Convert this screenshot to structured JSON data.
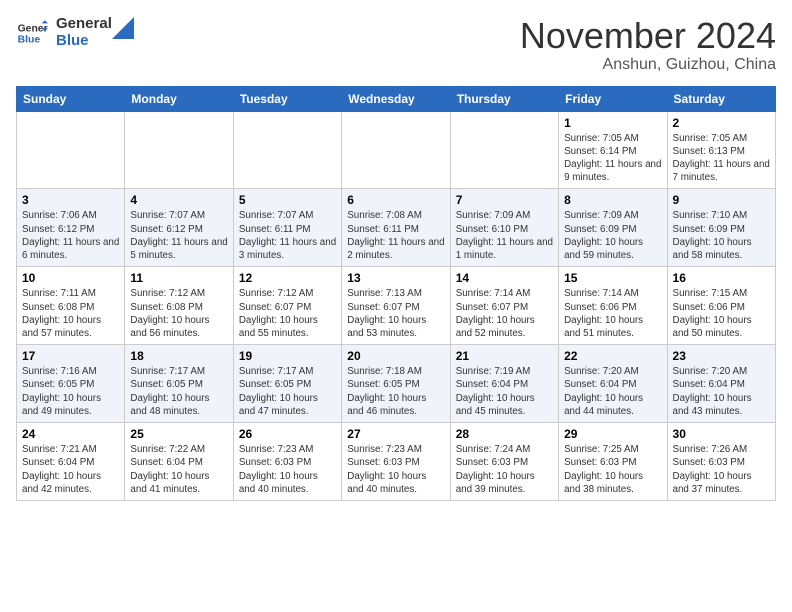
{
  "header": {
    "logo_line1": "General",
    "logo_line2": "Blue",
    "month": "November 2024",
    "location": "Anshun, Guizhou, China"
  },
  "weekdays": [
    "Sunday",
    "Monday",
    "Tuesday",
    "Wednesday",
    "Thursday",
    "Friday",
    "Saturday"
  ],
  "weeks": [
    [
      {
        "day": "",
        "info": ""
      },
      {
        "day": "",
        "info": ""
      },
      {
        "day": "",
        "info": ""
      },
      {
        "day": "",
        "info": ""
      },
      {
        "day": "",
        "info": ""
      },
      {
        "day": "1",
        "info": "Sunrise: 7:05 AM\nSunset: 6:14 PM\nDaylight: 11 hours and 9 minutes."
      },
      {
        "day": "2",
        "info": "Sunrise: 7:05 AM\nSunset: 6:13 PM\nDaylight: 11 hours and 7 minutes."
      }
    ],
    [
      {
        "day": "3",
        "info": "Sunrise: 7:06 AM\nSunset: 6:12 PM\nDaylight: 11 hours and 6 minutes."
      },
      {
        "day": "4",
        "info": "Sunrise: 7:07 AM\nSunset: 6:12 PM\nDaylight: 11 hours and 5 minutes."
      },
      {
        "day": "5",
        "info": "Sunrise: 7:07 AM\nSunset: 6:11 PM\nDaylight: 11 hours and 3 minutes."
      },
      {
        "day": "6",
        "info": "Sunrise: 7:08 AM\nSunset: 6:11 PM\nDaylight: 11 hours and 2 minutes."
      },
      {
        "day": "7",
        "info": "Sunrise: 7:09 AM\nSunset: 6:10 PM\nDaylight: 11 hours and 1 minute."
      },
      {
        "day": "8",
        "info": "Sunrise: 7:09 AM\nSunset: 6:09 PM\nDaylight: 10 hours and 59 minutes."
      },
      {
        "day": "9",
        "info": "Sunrise: 7:10 AM\nSunset: 6:09 PM\nDaylight: 10 hours and 58 minutes."
      }
    ],
    [
      {
        "day": "10",
        "info": "Sunrise: 7:11 AM\nSunset: 6:08 PM\nDaylight: 10 hours and 57 minutes."
      },
      {
        "day": "11",
        "info": "Sunrise: 7:12 AM\nSunset: 6:08 PM\nDaylight: 10 hours and 56 minutes."
      },
      {
        "day": "12",
        "info": "Sunrise: 7:12 AM\nSunset: 6:07 PM\nDaylight: 10 hours and 55 minutes."
      },
      {
        "day": "13",
        "info": "Sunrise: 7:13 AM\nSunset: 6:07 PM\nDaylight: 10 hours and 53 minutes."
      },
      {
        "day": "14",
        "info": "Sunrise: 7:14 AM\nSunset: 6:07 PM\nDaylight: 10 hours and 52 minutes."
      },
      {
        "day": "15",
        "info": "Sunrise: 7:14 AM\nSunset: 6:06 PM\nDaylight: 10 hours and 51 minutes."
      },
      {
        "day": "16",
        "info": "Sunrise: 7:15 AM\nSunset: 6:06 PM\nDaylight: 10 hours and 50 minutes."
      }
    ],
    [
      {
        "day": "17",
        "info": "Sunrise: 7:16 AM\nSunset: 6:05 PM\nDaylight: 10 hours and 49 minutes."
      },
      {
        "day": "18",
        "info": "Sunrise: 7:17 AM\nSunset: 6:05 PM\nDaylight: 10 hours and 48 minutes."
      },
      {
        "day": "19",
        "info": "Sunrise: 7:17 AM\nSunset: 6:05 PM\nDaylight: 10 hours and 47 minutes."
      },
      {
        "day": "20",
        "info": "Sunrise: 7:18 AM\nSunset: 6:05 PM\nDaylight: 10 hours and 46 minutes."
      },
      {
        "day": "21",
        "info": "Sunrise: 7:19 AM\nSunset: 6:04 PM\nDaylight: 10 hours and 45 minutes."
      },
      {
        "day": "22",
        "info": "Sunrise: 7:20 AM\nSunset: 6:04 PM\nDaylight: 10 hours and 44 minutes."
      },
      {
        "day": "23",
        "info": "Sunrise: 7:20 AM\nSunset: 6:04 PM\nDaylight: 10 hours and 43 minutes."
      }
    ],
    [
      {
        "day": "24",
        "info": "Sunrise: 7:21 AM\nSunset: 6:04 PM\nDaylight: 10 hours and 42 minutes."
      },
      {
        "day": "25",
        "info": "Sunrise: 7:22 AM\nSunset: 6:04 PM\nDaylight: 10 hours and 41 minutes."
      },
      {
        "day": "26",
        "info": "Sunrise: 7:23 AM\nSunset: 6:03 PM\nDaylight: 10 hours and 40 minutes."
      },
      {
        "day": "27",
        "info": "Sunrise: 7:23 AM\nSunset: 6:03 PM\nDaylight: 10 hours and 40 minutes."
      },
      {
        "day": "28",
        "info": "Sunrise: 7:24 AM\nSunset: 6:03 PM\nDaylight: 10 hours and 39 minutes."
      },
      {
        "day": "29",
        "info": "Sunrise: 7:25 AM\nSunset: 6:03 PM\nDaylight: 10 hours and 38 minutes."
      },
      {
        "day": "30",
        "info": "Sunrise: 7:26 AM\nSunset: 6:03 PM\nDaylight: 10 hours and 37 minutes."
      }
    ]
  ]
}
